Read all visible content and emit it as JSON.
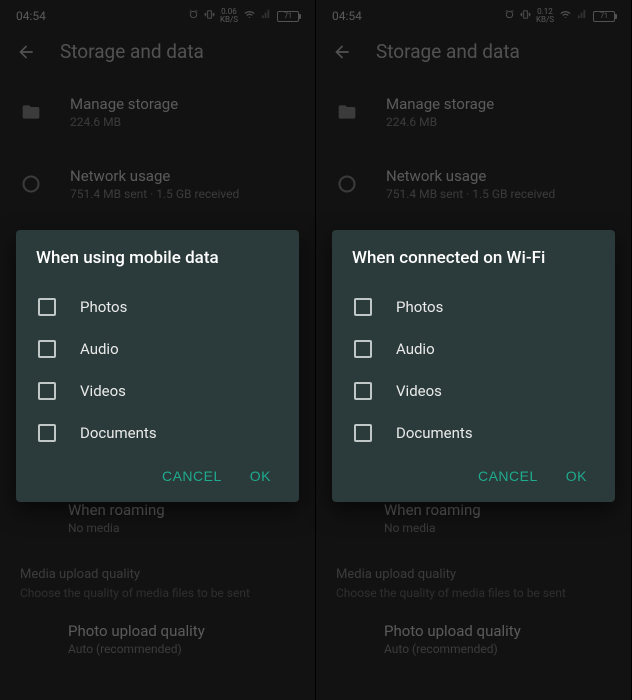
{
  "screens": [
    {
      "status": {
        "time": "04:54",
        "speed_val": "0.06",
        "speed_unit": "KB/S",
        "battery": "71"
      },
      "header": {
        "title": "Storage and data"
      },
      "storage": {
        "title": "Manage storage",
        "sub": "224.6 MB"
      },
      "network": {
        "title": "Network usage",
        "sub": "751.4 MB sent · 1.5 GB received"
      },
      "dialog": {
        "title": "When using mobile data",
        "options": [
          "Photos",
          "Audio",
          "Videos",
          "Documents"
        ],
        "cancel": "CANCEL",
        "ok": "OK"
      },
      "roaming": {
        "title": "When roaming",
        "sub": "No media"
      },
      "quality_section": {
        "label": "Media upload quality",
        "sub": "Choose the quality of media files to be sent"
      },
      "photo_quality": {
        "title": "Photo upload quality",
        "sub": "Auto (recommended)"
      }
    },
    {
      "status": {
        "time": "04:54",
        "speed_val": "0.12",
        "speed_unit": "KB/S",
        "battery": "71"
      },
      "header": {
        "title": "Storage and data"
      },
      "storage": {
        "title": "Manage storage",
        "sub": "224.6 MB"
      },
      "network": {
        "title": "Network usage",
        "sub": "751.4 MB sent · 1.5 GB received"
      },
      "dialog": {
        "title": "When connected on Wi-Fi",
        "options": [
          "Photos",
          "Audio",
          "Videos",
          "Documents"
        ],
        "cancel": "CANCEL",
        "ok": "OK"
      },
      "roaming": {
        "title": "When roaming",
        "sub": "No media"
      },
      "quality_section": {
        "label": "Media upload quality",
        "sub": "Choose the quality of media files to be sent"
      },
      "photo_quality": {
        "title": "Photo upload quality",
        "sub": "Auto (recommended)"
      }
    }
  ]
}
